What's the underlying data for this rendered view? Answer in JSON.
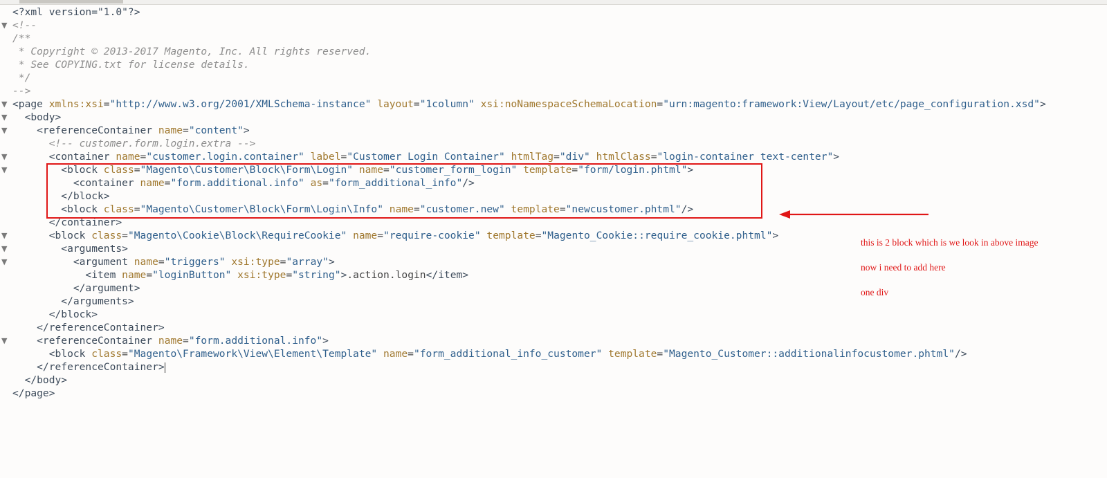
{
  "accent_color": "#e01616",
  "editor": {
    "lines": [
      {
        "fold": "",
        "segments": [
          {
            "t": "tag",
            "v": "<?xml version=\"1.0\"?>"
          }
        ]
      },
      {
        "fold": "▼",
        "segments": [
          {
            "t": "com",
            "v": "<!--"
          }
        ]
      },
      {
        "fold": "",
        "segments": [
          {
            "t": "com",
            "v": "/**"
          }
        ]
      },
      {
        "fold": "",
        "segments": [
          {
            "t": "com",
            "v": " * Copyright © 2013-2017 Magento, Inc. All rights reserved."
          }
        ]
      },
      {
        "fold": "",
        "segments": [
          {
            "t": "com",
            "v": " * See COPYING.txt for license details."
          }
        ]
      },
      {
        "fold": "",
        "segments": [
          {
            "t": "com",
            "v": " */"
          }
        ]
      },
      {
        "fold": "",
        "segments": [
          {
            "t": "com",
            "v": "-->"
          }
        ]
      },
      {
        "fold": "▼",
        "segments": [
          {
            "t": "tag",
            "v": "<page "
          },
          {
            "t": "attr",
            "v": "xmlns:xsi"
          },
          {
            "t": "txt",
            "v": "="
          },
          {
            "t": "str",
            "v": "\"http://www.w3.org/2001/XMLSchema-instance\""
          },
          {
            "t": "txt",
            "v": " "
          },
          {
            "t": "attr",
            "v": "layout"
          },
          {
            "t": "txt",
            "v": "="
          },
          {
            "t": "str",
            "v": "\"1column\""
          },
          {
            "t": "txt",
            "v": " "
          },
          {
            "t": "attr",
            "v": "xsi:noNamespaceSchemaLocation"
          },
          {
            "t": "txt",
            "v": "="
          },
          {
            "t": "str",
            "v": "\"urn:magento:framework:View/Layout/etc/page_configuration.xsd\""
          },
          {
            "t": "tag",
            "v": ">"
          }
        ]
      },
      {
        "fold": "▼",
        "segments": [
          {
            "t": "tag",
            "v": "  <body>"
          }
        ]
      },
      {
        "fold": "▼",
        "segments": [
          {
            "t": "tag",
            "v": "    <referenceContainer "
          },
          {
            "t": "attr",
            "v": "name"
          },
          {
            "t": "txt",
            "v": "="
          },
          {
            "t": "str",
            "v": "\"content\""
          },
          {
            "t": "tag",
            "v": ">"
          }
        ]
      },
      {
        "fold": "",
        "segments": [
          {
            "t": "com",
            "v": "      <!-- customer.form.login.extra -->"
          }
        ]
      },
      {
        "fold": "▼",
        "segments": [
          {
            "t": "tag",
            "v": "      <container "
          },
          {
            "t": "attr",
            "v": "name"
          },
          {
            "t": "txt",
            "v": "="
          },
          {
            "t": "str",
            "v": "\"customer.login.container\""
          },
          {
            "t": "txt",
            "v": " "
          },
          {
            "t": "attr",
            "v": "label"
          },
          {
            "t": "txt",
            "v": "="
          },
          {
            "t": "str",
            "v": "\"Customer Login Container\""
          },
          {
            "t": "txt",
            "v": " "
          },
          {
            "t": "attr",
            "v": "htmlTag"
          },
          {
            "t": "txt",
            "v": "="
          },
          {
            "t": "str",
            "v": "\"div\""
          },
          {
            "t": "txt",
            "v": " "
          },
          {
            "t": "attr",
            "v": "htmlClass"
          },
          {
            "t": "txt",
            "v": "="
          },
          {
            "t": "str",
            "v": "\"login-container text-center\""
          },
          {
            "t": "tag",
            "v": ">"
          }
        ]
      },
      {
        "fold": "▼",
        "segments": [
          {
            "t": "tag",
            "v": "        <block "
          },
          {
            "t": "attr",
            "v": "class"
          },
          {
            "t": "txt",
            "v": "="
          },
          {
            "t": "str",
            "v": "\"Magento\\Customer\\Block\\Form\\Login\""
          },
          {
            "t": "txt",
            "v": " "
          },
          {
            "t": "attr",
            "v": "name"
          },
          {
            "t": "txt",
            "v": "="
          },
          {
            "t": "str",
            "v": "\"customer_form_login\""
          },
          {
            "t": "txt",
            "v": " "
          },
          {
            "t": "attr",
            "v": "template"
          },
          {
            "t": "txt",
            "v": "="
          },
          {
            "t": "str",
            "v": "\"form/login.phtml\""
          },
          {
            "t": "tag",
            "v": ">"
          }
        ]
      },
      {
        "fold": "",
        "segments": [
          {
            "t": "tag",
            "v": "          <container "
          },
          {
            "t": "attr",
            "v": "name"
          },
          {
            "t": "txt",
            "v": "="
          },
          {
            "t": "str",
            "v": "\"form.additional.info\""
          },
          {
            "t": "txt",
            "v": " "
          },
          {
            "t": "attr",
            "v": "as"
          },
          {
            "t": "txt",
            "v": "="
          },
          {
            "t": "str",
            "v": "\"form_additional_info\""
          },
          {
            "t": "tag",
            "v": "/>"
          }
        ]
      },
      {
        "fold": "",
        "segments": [
          {
            "t": "tag",
            "v": "        </block>"
          }
        ]
      },
      {
        "fold": "",
        "segments": [
          {
            "t": "tag",
            "v": "        <block "
          },
          {
            "t": "attr",
            "v": "class"
          },
          {
            "t": "txt",
            "v": "="
          },
          {
            "t": "str",
            "v": "\"Magento\\Customer\\Block\\Form\\Login\\Info\""
          },
          {
            "t": "txt",
            "v": " "
          },
          {
            "t": "attr",
            "v": "name"
          },
          {
            "t": "txt",
            "v": "="
          },
          {
            "t": "str",
            "v": "\"customer.new\""
          },
          {
            "t": "txt",
            "v": " "
          },
          {
            "t": "attr",
            "v": "template"
          },
          {
            "t": "txt",
            "v": "="
          },
          {
            "t": "str",
            "v": "\"newcustomer.phtml\""
          },
          {
            "t": "tag",
            "v": "/>"
          }
        ]
      },
      {
        "fold": "",
        "segments": [
          {
            "t": "tag",
            "v": "      </container>"
          }
        ]
      },
      {
        "fold": "▼",
        "segments": [
          {
            "t": "tag",
            "v": "      <block "
          },
          {
            "t": "attr",
            "v": "class"
          },
          {
            "t": "txt",
            "v": "="
          },
          {
            "t": "str",
            "v": "\"Magento\\Cookie\\Block\\RequireCookie\""
          },
          {
            "t": "txt",
            "v": " "
          },
          {
            "t": "attr",
            "v": "name"
          },
          {
            "t": "txt",
            "v": "="
          },
          {
            "t": "str",
            "v": "\"require-cookie\""
          },
          {
            "t": "txt",
            "v": " "
          },
          {
            "t": "attr",
            "v": "template"
          },
          {
            "t": "txt",
            "v": "="
          },
          {
            "t": "str",
            "v": "\"Magento_Cookie::require_cookie.phtml\""
          },
          {
            "t": "tag",
            "v": ">"
          }
        ]
      },
      {
        "fold": "▼",
        "segments": [
          {
            "t": "tag",
            "v": "        <arguments>"
          }
        ]
      },
      {
        "fold": "▼",
        "segments": [
          {
            "t": "tag",
            "v": "          <argument "
          },
          {
            "t": "attr",
            "v": "name"
          },
          {
            "t": "txt",
            "v": "="
          },
          {
            "t": "str",
            "v": "\"triggers\""
          },
          {
            "t": "txt",
            "v": " "
          },
          {
            "t": "attr",
            "v": "xsi:type"
          },
          {
            "t": "txt",
            "v": "="
          },
          {
            "t": "str",
            "v": "\"array\""
          },
          {
            "t": "tag",
            "v": ">"
          }
        ]
      },
      {
        "fold": "",
        "segments": [
          {
            "t": "tag",
            "v": "            <item "
          },
          {
            "t": "attr",
            "v": "name"
          },
          {
            "t": "txt",
            "v": "="
          },
          {
            "t": "str",
            "v": "\"loginButton\""
          },
          {
            "t": "txt",
            "v": " "
          },
          {
            "t": "attr",
            "v": "xsi:type"
          },
          {
            "t": "txt",
            "v": "="
          },
          {
            "t": "str",
            "v": "\"string\""
          },
          {
            "t": "tag",
            "v": ">"
          },
          {
            "t": "txt",
            "v": ".action.login"
          },
          {
            "t": "tag",
            "v": "</item>"
          }
        ]
      },
      {
        "fold": "",
        "segments": [
          {
            "t": "tag",
            "v": "          </argument>"
          }
        ]
      },
      {
        "fold": "",
        "segments": [
          {
            "t": "tag",
            "v": "        </arguments>"
          }
        ]
      },
      {
        "fold": "",
        "segments": [
          {
            "t": "tag",
            "v": "      </block>"
          }
        ]
      },
      {
        "fold": "",
        "segments": [
          {
            "t": "tag",
            "v": "    </referenceContainer>"
          }
        ]
      },
      {
        "fold": "▼",
        "segments": [
          {
            "t": "tag",
            "v": "    <referenceContainer "
          },
          {
            "t": "attr",
            "v": "name"
          },
          {
            "t": "txt",
            "v": "="
          },
          {
            "t": "str",
            "v": "\"form.additional.info\""
          },
          {
            "t": "tag",
            "v": ">"
          }
        ]
      },
      {
        "fold": "",
        "segments": [
          {
            "t": "tag",
            "v": "      <block "
          },
          {
            "t": "attr",
            "v": "class"
          },
          {
            "t": "txt",
            "v": "="
          },
          {
            "t": "str",
            "v": "\"Magento\\Framework\\View\\Element\\Template\""
          },
          {
            "t": "txt",
            "v": " "
          },
          {
            "t": "attr",
            "v": "name"
          },
          {
            "t": "txt",
            "v": "="
          },
          {
            "t": "str",
            "v": "\"form_additional_info_customer\""
          },
          {
            "t": "txt",
            "v": " "
          },
          {
            "t": "attr",
            "v": "template"
          },
          {
            "t": "txt",
            "v": "="
          },
          {
            "t": "str",
            "v": "\"Magento_Customer::additionalinfocustomer.phtml\""
          },
          {
            "t": "tag",
            "v": "/>"
          }
        ]
      },
      {
        "fold": "",
        "segments": [
          {
            "t": "tag",
            "v": "    </referenceContainer>"
          }
        ],
        "caret": true
      },
      {
        "fold": "",
        "segments": [
          {
            "t": "tag",
            "v": "  </body>"
          }
        ]
      },
      {
        "fold": "",
        "segments": [
          {
            "t": "tag",
            "v": "</page>"
          }
        ]
      }
    ]
  },
  "annotation": {
    "notes": [
      "this is 2 block which is we look in above image",
      "now i need to add here",
      "one div"
    ]
  }
}
